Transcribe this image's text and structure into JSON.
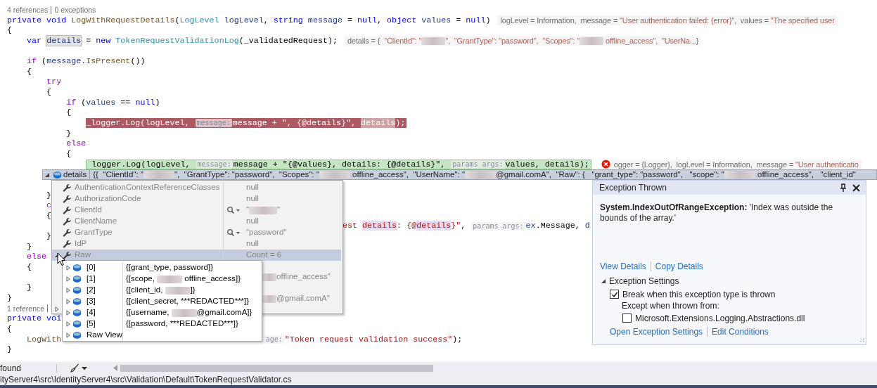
{
  "editor": {
    "lines": [
      {
        "kind": "codelens",
        "links": [
          "4 references",
          "0 exceptions"
        ]
      },
      {
        "kind": "code",
        "parts": [
          {
            "text": "private void ",
            "kind": "kw"
          },
          {
            "text": "LogWithRequestDetails",
            "kind": "fn"
          },
          {
            "text": "(",
            "kind": "p"
          },
          {
            "text": "LogLevel",
            "kind": "ty"
          },
          {
            "text": " logLevel",
            "kind": "loc"
          },
          {
            "text": ", ",
            "kind": "p"
          },
          {
            "text": "string",
            "kind": "kw"
          },
          {
            "text": " message",
            "kind": "loc"
          },
          {
            "text": " = ",
            "kind": "p"
          },
          {
            "text": "null",
            "kind": "kw"
          },
          {
            "text": ", ",
            "kind": "p"
          },
          {
            "text": "object",
            "kind": "kw"
          },
          {
            "text": " values",
            "kind": "loc"
          },
          {
            "text": " = ",
            "kind": "p"
          },
          {
            "text": "null",
            "kind": "kw"
          },
          {
            "text": ")",
            "kind": "p"
          }
        ],
        "hint": [
          {
            "text": "logLevel = Information,  message = ",
            "kind": "n"
          },
          {
            "text": "\"User authentication failed: {error}\"",
            "kind": "s"
          },
          {
            "text": ",  values = ",
            "kind": "n"
          },
          {
            "text": "\"The specified user",
            "kind": "s"
          }
        ]
      },
      {
        "kind": "code",
        "parts": [
          {
            "text": "{",
            "kind": "p"
          }
        ]
      },
      {
        "kind": "code",
        "parts": [
          {
            "text": "    var ",
            "kind": "kw"
          },
          {
            "text": "details",
            "kind": "ref"
          },
          {
            "text": " = ",
            "kind": "p"
          },
          {
            "text": "new ",
            "kind": "kw"
          },
          {
            "text": "TokenRequestValidationLog",
            "kind": "ty"
          },
          {
            "text": "(_validatedRequest);",
            "kind": "p"
          }
        ],
        "hint": [
          {
            "text": "details = {  ",
            "kind": "n"
          },
          {
            "text": "\"ClientId\": \"",
            "kind": "s"
          },
          {
            "kind": "blur"
          },
          {
            "text": "\",  \"GrantType\": \"password\",  \"Scopes\": \"",
            "kind": "s"
          },
          {
            "kind": "blur"
          },
          {
            "text": " offline_access\",  \"UserNa...",
            "kind": "s"
          },
          {
            "text": "}",
            "kind": "n"
          }
        ]
      },
      {
        "kind": "blank"
      },
      {
        "kind": "code",
        "parts": [
          {
            "text": "    if",
            "kind": "ctl"
          },
          {
            "text": " (",
            "kind": "p"
          },
          {
            "text": "message",
            "kind": "loc"
          },
          {
            "text": ".",
            "kind": "p"
          },
          {
            "text": "IsPresent",
            "kind": "fn"
          },
          {
            "text": "())",
            "kind": "p"
          }
        ]
      },
      {
        "kind": "code",
        "parts": [
          {
            "text": "    {",
            "kind": "p"
          }
        ]
      },
      {
        "kind": "code",
        "parts": [
          {
            "text": "        try",
            "kind": "ctl"
          }
        ]
      },
      {
        "kind": "code",
        "parts": [
          {
            "text": "        {",
            "kind": "p"
          }
        ]
      },
      {
        "kind": "code",
        "parts": [
          {
            "text": "            if",
            "kind": "ctl"
          },
          {
            "text": " (",
            "kind": "p"
          },
          {
            "text": "values",
            "kind": "loc"
          },
          {
            "text": " == ",
            "kind": "p"
          },
          {
            "text": "null",
            "kind": "kw"
          },
          {
            "text": ")",
            "kind": "p"
          }
        ]
      },
      {
        "kind": "code",
        "parts": [
          {
            "text": "            {",
            "kind": "p"
          }
        ]
      },
      {
        "kind": "breakpoint",
        "parts": [
          {
            "text": "                _logger.",
            "kind": "p"
          },
          {
            "text": "Log",
            "kind": "fn"
          },
          {
            "text": "(",
            "kind": "p"
          },
          {
            "text": "logLevel",
            "kind": "loc"
          },
          {
            "text": ", ",
            "kind": "p"
          },
          {
            "text": "message:",
            "kind": "hint"
          },
          {
            "text": "message",
            "kind": "loc"
          },
          {
            "text": " + ",
            "kind": "p"
          },
          {
            "text": "\", {@details}\"",
            "kind": "s"
          },
          {
            "text": ", ",
            "kind": "p"
          },
          {
            "text": "details",
            "kind": "ref"
          },
          {
            "text": ");",
            "kind": "p"
          }
        ]
      },
      {
        "kind": "code",
        "parts": [
          {
            "text": "            }",
            "kind": "p"
          }
        ]
      },
      {
        "kind": "code",
        "parts": [
          {
            "text": "            else",
            "kind": "ctl"
          }
        ]
      },
      {
        "kind": "code",
        "parts": [
          {
            "text": "            {",
            "kind": "p"
          }
        ]
      },
      {
        "kind": "current",
        "error": true,
        "parts": [
          {
            "text": "                logger.",
            "kind": "p"
          },
          {
            "text": "Log",
            "kind": "fn"
          },
          {
            "text": "(",
            "kind": "p"
          },
          {
            "text": "logLevel",
            "kind": "loc"
          },
          {
            "text": ", ",
            "kind": "p"
          },
          {
            "text": "message:",
            "kind": "hint"
          },
          {
            "text": "message",
            "kind": "loc"
          },
          {
            "text": " + ",
            "kind": "p"
          },
          {
            "text": "\"{@values}, details: {@details}\"",
            "kind": "s"
          },
          {
            "text": ", ",
            "kind": "p"
          },
          {
            "text": "params args:",
            "kind": "hint"
          },
          {
            "text": "values",
            "kind": "loc"
          },
          {
            "text": ", ",
            "kind": "p"
          },
          {
            "text": "details",
            "kind": "loc"
          },
          {
            "text": ");",
            "kind": "p"
          }
        ],
        "hint": [
          {
            "text": "ogger = {Logger},  logLevel = Information,  message = ",
            "kind": "n"
          },
          {
            "text": "\"User authenticatio",
            "kind": "s"
          }
        ]
      },
      {
        "kind": "blank"
      },
      {
        "kind": "blank"
      },
      {
        "kind": "code",
        "parts": [
          {
            "text": "        }",
            "kind": "p"
          }
        ]
      },
      {
        "kind": "code",
        "parts": [
          {
            "text": "        c",
            "kind": "ctl"
          }
        ]
      },
      {
        "kind": "code",
        "parts": [
          {
            "text": "        {",
            "kind": "p"
          }
        ]
      },
      {
        "kind": "code",
        "parts": [
          {
            "text": "                                                                    est ",
            "kind": "s"
          },
          {
            "text": "details",
            "kind": "refs"
          },
          {
            "text": ": {@",
            "kind": "s"
          },
          {
            "text": "details",
            "kind": "refs"
          },
          {
            "text": "}\"",
            "kind": "s"
          },
          {
            "text": ", ",
            "kind": "p"
          },
          {
            "text": "params args:",
            "kind": "hint"
          },
          {
            "text": "ex",
            "kind": "loc"
          },
          {
            "text": ".Message, ",
            "kind": "p"
          },
          {
            "text": "d",
            "kind": "loc"
          }
        ]
      },
      {
        "kind": "code",
        "parts": [
          {
            "text": "        }",
            "kind": "p"
          }
        ]
      },
      {
        "kind": "code",
        "parts": [
          {
            "text": "    }",
            "kind": "p"
          }
        ]
      },
      {
        "kind": "code",
        "parts": [
          {
            "text": "    else",
            "kind": "ctl"
          }
        ]
      },
      {
        "kind": "code",
        "parts": [
          {
            "text": "    {",
            "kind": "p"
          }
        ]
      },
      {
        "kind": "blank"
      },
      {
        "kind": "code",
        "parts": [
          {
            "text": "    }",
            "kind": "p"
          }
        ]
      },
      {
        "kind": "code",
        "parts": [
          {
            "text": "}",
            "kind": "p"
          }
        ]
      },
      {
        "kind": "codelens",
        "links": [
          "1 reference"
        ],
        "more": true
      },
      {
        "kind": "code",
        "parts": [
          {
            "text": "private voi",
            "kind": "kw"
          }
        ]
      },
      {
        "kind": "code",
        "parts": [
          {
            "text": "{",
            "kind": "p"
          }
        ]
      },
      {
        "kind": "code",
        "parts": [
          {
            "text": "    LogWith                                         ",
            "kind": "fn"
          },
          {
            "text": "age:",
            "kind": "hint"
          },
          {
            "text": "\"Token request validation success\"",
            "kind": "s"
          },
          {
            "text": ");",
            "kind": "p"
          }
        ]
      },
      {
        "kind": "code",
        "parts": [
          {
            "text": "}",
            "kind": "p"
          }
        ]
      }
    ]
  },
  "datatip": {
    "name": "details",
    "expanded": true,
    "value": [
      {
        "text": "{{  \"ClientId\": \""
      },
      {
        "kind": "blur"
      },
      {
        "text": "\",  \"GrantType\": \"password\",  \"Scopes\": \""
      },
      {
        "kind": "blur"
      },
      {
        "text": " offline_access\",  \"UserName\": \""
      },
      {
        "kind": "blur"
      },
      {
        "text": "@gmail.comA\",  \"Raw\": {   \"grant_type\": \"password\",   \"scope\": \""
      },
      {
        "kind": "blur"
      },
      {
        "text": " offline_access\",   \"client_id\""
      }
    ],
    "members": [
      {
        "name": "AuthenticationContextReferenceClasses",
        "selected": false,
        "value": [
          {
            "text": "null"
          }
        ]
      },
      {
        "name": "AuthorizationCode",
        "selected": false,
        "value": [
          {
            "text": "null"
          }
        ]
      },
      {
        "name": "ClientId",
        "selected": false,
        "visualizer": true,
        "value": [
          {
            "text": "\""
          },
          {
            "kind": "blur"
          },
          {
            "text": "\""
          }
        ]
      },
      {
        "name": "ClientName",
        "selected": false,
        "value": [
          {
            "text": "null"
          }
        ]
      },
      {
        "name": "GrantType",
        "selected": false,
        "visualizer": true,
        "value": [
          {
            "text": "\"password\""
          }
        ]
      },
      {
        "name": "IdP",
        "selected": false,
        "value": [
          {
            "text": "null"
          }
        ]
      },
      {
        "name": "Raw",
        "selected": true,
        "expanded": true,
        "value": [
          {
            "text": "Count = 6"
          }
        ]
      }
    ],
    "covered_members": [
      {
        "value": [
          {
            "kind": "blur"
          },
          {
            "text": "offline_access\""
          }
        ]
      },
      {
        "value": [
          {
            "kind": "blur"
          },
          {
            "text": "@gmail.comA\""
          }
        ]
      },
      {
        "expanded": false
      }
    ],
    "raw_items": [
      {
        "index": "[0]",
        "expanded": false,
        "value": [
          {
            "text": "{[grant_type, password]}"
          }
        ]
      },
      {
        "index": "[1]",
        "expanded": false,
        "value": [
          {
            "text": "{[scope, "
          },
          {
            "kind": "blur"
          },
          {
            "text": " offline_access]}"
          }
        ]
      },
      {
        "index": "[2]",
        "expanded": false,
        "value": [
          {
            "text": "{[client_id, "
          },
          {
            "kind": "blur"
          },
          {
            "text": "]}"
          }
        ]
      },
      {
        "index": "[3]",
        "expanded": false,
        "value": [
          {
            "text": "{[client_secret, ***REDACTED***]}"
          }
        ]
      },
      {
        "index": "[4]",
        "expanded": false,
        "value": [
          {
            "text": "{[username, "
          },
          {
            "kind": "blur"
          },
          {
            "text": "@gmail.comA]}"
          }
        ]
      },
      {
        "index": "[5]",
        "expanded": false,
        "value": [
          {
            "text": "{[password, ***REDACTED***]}"
          }
        ]
      },
      {
        "index": "Raw View",
        "expanded": false
      }
    ]
  },
  "exception": {
    "title": "Exception Thrown",
    "message": "**System.IndexOutOfRangeException:** 'Index was outside the bounds of the array.'",
    "links": [
      "View Details",
      "Copy Details"
    ],
    "settings": {
      "title": "Exception Settings",
      "expanded": true,
      "break_option": {
        "label": "Break when this exception type is thrown",
        "checked": true
      },
      "except_label": "Except when thrown from:",
      "modules": [
        {
          "label": "Microsoft.Extensions.Logging.Abstractions.dll",
          "checked": false
        }
      ],
      "links": [
        "Open Exception Settings",
        "Edit Conditions"
      ]
    }
  },
  "status_bar": {
    "text": "found"
  },
  "file_path": "ityServer4\\src\\IdentityServer4\\src\\Validation\\Default\\TokenRequestValidator.cs"
}
